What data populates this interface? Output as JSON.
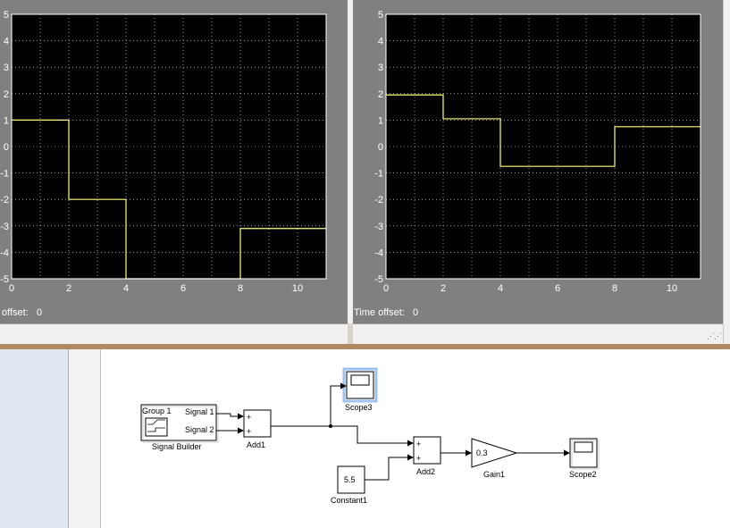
{
  "scopes": [
    {
      "name": "left",
      "y_ticks": [
        "5",
        "4",
        "3",
        "2",
        "1",
        "0",
        "-1",
        "-2",
        "-3",
        "-4",
        "-5"
      ],
      "x_ticks": [
        "0",
        "2",
        "4",
        "6",
        "8",
        "10"
      ],
      "offset_text": "offset:",
      "offset_value": "0",
      "trace_color": "#ffff7f",
      "trace": [
        [
          0,
          1
        ],
        [
          2,
          1
        ],
        [
          2,
          -2
        ],
        [
          4,
          -2
        ],
        [
          4,
          -5
        ],
        [
          8,
          -5
        ],
        [
          8,
          -3.1
        ],
        [
          11,
          -3.1
        ]
      ]
    },
    {
      "name": "right",
      "y_ticks": [
        "5",
        "4",
        "3",
        "2",
        "1",
        "0",
        "-1",
        "-2",
        "-3",
        "-4",
        "-5"
      ],
      "x_ticks": [
        "0",
        "2",
        "4",
        "6",
        "8",
        "10"
      ],
      "offset_text": "Time offset:",
      "offset_value": "0",
      "trace_color": "#ffff7f",
      "trace": [
        [
          0,
          1.95
        ],
        [
          2,
          1.95
        ],
        [
          2,
          1.05
        ],
        [
          4,
          1.05
        ],
        [
          4,
          -0.75
        ],
        [
          8,
          -0.75
        ],
        [
          8,
          0.75
        ],
        [
          11,
          0.75
        ]
      ]
    }
  ],
  "model": {
    "signal_builder": {
      "group": "Group 1",
      "signal1": "Signal 1",
      "signal2": "Signal 2",
      "label": "Signal Builder"
    },
    "add1": {
      "label": "Add1",
      "plus": "+"
    },
    "add2": {
      "label": "Add2",
      "plus": "+"
    },
    "scope3": {
      "label": "Scope3"
    },
    "scope2": {
      "label": "Scope2"
    },
    "gain1": {
      "label": "Gain1",
      "value": "0.3"
    },
    "constant1": {
      "label": "Constant1",
      "value": "5.5"
    }
  },
  "colors": {
    "plot_bg": "#000000",
    "grid": "#ffffff",
    "frame_bg": "#808080",
    "selection": "#9cc3f0"
  }
}
